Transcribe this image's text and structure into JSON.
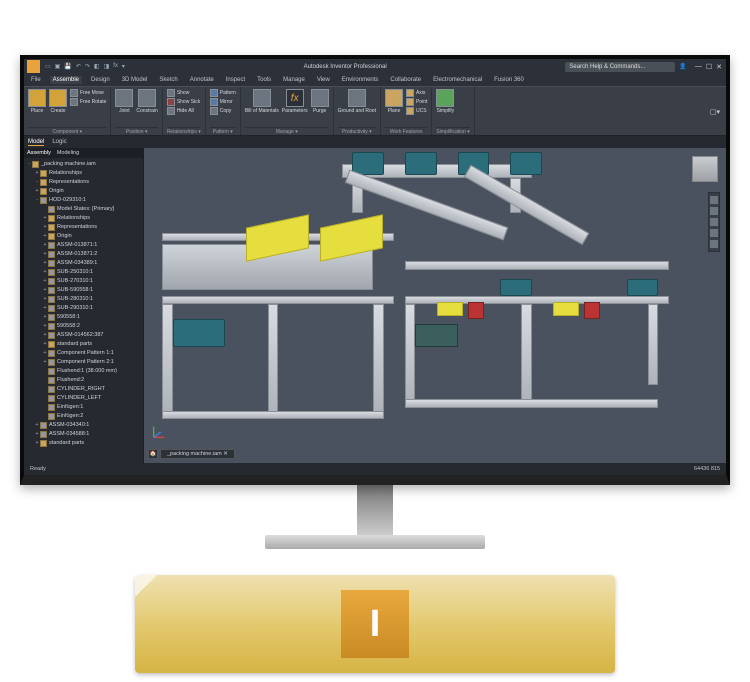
{
  "app": {
    "title": "Autodesk Inventor Professional",
    "search_placeholder": "Search Help & Commands...",
    "quick_access": [
      "New",
      "Open",
      "Save",
      "Undo",
      "Redo",
      "Appearance",
      "Material",
      "fx"
    ]
  },
  "tabs": [
    "File",
    "Assemble",
    "Design",
    "3D Model",
    "Sketch",
    "Annotate",
    "Inspect",
    "Tools",
    "Manage",
    "View",
    "Environments",
    "Collaborate",
    "Electromechanical",
    "Fusion 360"
  ],
  "active_tab": "Assemble",
  "ribbon": {
    "component": {
      "label": "Component ▾",
      "place": "Place",
      "create": "Create",
      "free_move": "Free Move",
      "free_rotate": "Free Rotate"
    },
    "position": {
      "label": "Position ▾",
      "joint": "Joint",
      "constrain": "Constrain"
    },
    "relationships": {
      "label": "Relationships ▾",
      "show": "Show",
      "show_sick": "Show Sick",
      "hide_all": "Hide All"
    },
    "pattern": {
      "label": "Pattern ▾",
      "pattern": "Pattern",
      "mirror": "Mirror",
      "copy": "Copy"
    },
    "manage": {
      "label": "Manage ▾",
      "bom": "Bill of Materials",
      "parameters": "Parameters",
      "purge": "Purge"
    },
    "productivity": {
      "label": "Productivity ▾"
    },
    "work_features": {
      "label": "Work Features",
      "plane": "Plane",
      "axis": "Axis",
      "point": "Point",
      "ucs": "UCS",
      "ground": "Ground and Root"
    },
    "simplification": {
      "label": "Simplification ▾",
      "simplify": "Simplify"
    }
  },
  "panel_tabs": [
    "Model",
    "Logic"
  ],
  "browser_header": {
    "tab_a": "Assembly",
    "tab_b": "Modeling"
  },
  "doc_name": "_packing machine.iam",
  "tree": [
    {
      "depth": 0,
      "exp": "-",
      "icon": "folder",
      "label": "_packing machine.iam"
    },
    {
      "depth": 1,
      "exp": "+",
      "icon": "folder",
      "label": "Relationships"
    },
    {
      "depth": 1,
      "exp": "-",
      "icon": "folder",
      "label": "Representations"
    },
    {
      "depth": 1,
      "exp": "+",
      "icon": "folder",
      "label": "Origin"
    },
    {
      "depth": 1,
      "exp": "-",
      "icon": "part",
      "label": "HOD-029310:1"
    },
    {
      "depth": 2,
      "exp": " ",
      "icon": "part",
      "label": "Model States: [Primary]"
    },
    {
      "depth": 2,
      "exp": "+",
      "icon": "folder",
      "label": "Relationships"
    },
    {
      "depth": 2,
      "exp": "+",
      "icon": "folder",
      "label": "Representations"
    },
    {
      "depth": 2,
      "exp": "+",
      "icon": "folder",
      "label": "Origin"
    },
    {
      "depth": 2,
      "exp": "+",
      "icon": "part",
      "label": "ASSM-013871:1"
    },
    {
      "depth": 2,
      "exp": "+",
      "icon": "part",
      "label": "ASSM-013871:2"
    },
    {
      "depth": 2,
      "exp": "+",
      "icon": "part",
      "label": "ASSM-034389:1"
    },
    {
      "depth": 2,
      "exp": "+",
      "icon": "part",
      "label": "SUB-250310:1"
    },
    {
      "depth": 2,
      "exp": "+",
      "icon": "part",
      "label": "SUB-270310:1"
    },
    {
      "depth": 2,
      "exp": "+",
      "icon": "part",
      "label": "SUB-590558:1"
    },
    {
      "depth": 2,
      "exp": "+",
      "icon": "part",
      "label": "SUB-280310:1"
    },
    {
      "depth": 2,
      "exp": "+",
      "icon": "part",
      "label": "SUB-290310:1"
    },
    {
      "depth": 2,
      "exp": "+",
      "icon": "part",
      "label": "590558:1"
    },
    {
      "depth": 2,
      "exp": "+",
      "icon": "part",
      "label": "590558:2"
    },
    {
      "depth": 2,
      "exp": "+",
      "icon": "part",
      "label": "ASSM-014562:387"
    },
    {
      "depth": 2,
      "exp": "+",
      "icon": "folder",
      "label": "standard parts"
    },
    {
      "depth": 2,
      "exp": "+",
      "icon": "part",
      "label": "Component Pattern 1:1"
    },
    {
      "depth": 2,
      "exp": "+",
      "icon": "part",
      "label": "Component Pattern 2:1"
    },
    {
      "depth": 2,
      "exp": " ",
      "icon": "part",
      "label": "Flushend:1 (38.000 mm)"
    },
    {
      "depth": 2,
      "exp": " ",
      "icon": "part",
      "label": "Flushend:2"
    },
    {
      "depth": 2,
      "exp": " ",
      "icon": "part",
      "label": "CYLINDER_RIGHT"
    },
    {
      "depth": 2,
      "exp": " ",
      "icon": "part",
      "label": "CYLINDER_LEFT"
    },
    {
      "depth": 2,
      "exp": " ",
      "icon": "part",
      "label": "Einfügen:1"
    },
    {
      "depth": 2,
      "exp": " ",
      "icon": "part",
      "label": "Einfügen:2"
    },
    {
      "depth": 1,
      "exp": "+",
      "icon": "part",
      "label": "ASSM-034340:1"
    },
    {
      "depth": 1,
      "exp": "+",
      "icon": "part",
      "label": "ASSM-034588:1"
    },
    {
      "depth": 1,
      "exp": "+",
      "icon": "folder",
      "label": "standard parts"
    }
  ],
  "doc_tab": {
    "active": "_packing machine.iam"
  },
  "status": {
    "left": "Ready",
    "right": "64436  815"
  },
  "logo": {
    "letter": "I"
  }
}
